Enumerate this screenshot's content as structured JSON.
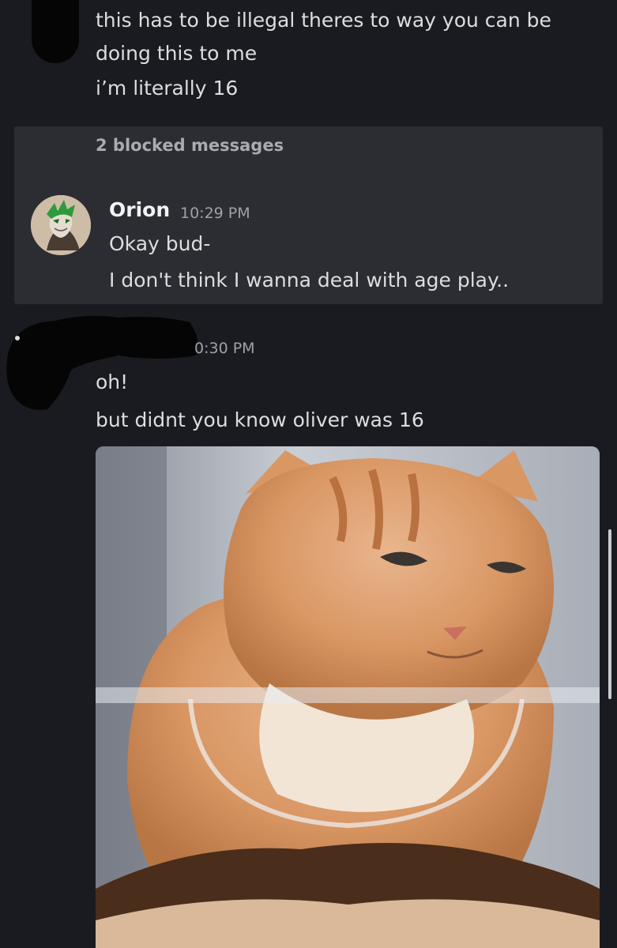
{
  "messages_top": {
    "line1": "this has to be illegal theres to way you can be",
    "line2": "doing this to me",
    "line3": "i’m literally 16"
  },
  "blocked": {
    "label": "2 blocked messages",
    "author": "Orion",
    "timestamp": "10:29 PM",
    "line1": "Okay bud-",
    "line2": "I don't think I wanna deal with age play.."
  },
  "reply": {
    "timestamp_visible": "0:30 PM",
    "line1": "oh!",
    "line2": "but didnt you know oliver was 16"
  },
  "icons": {
    "avatar": "avatar-icon",
    "attachment": "cat-image"
  }
}
